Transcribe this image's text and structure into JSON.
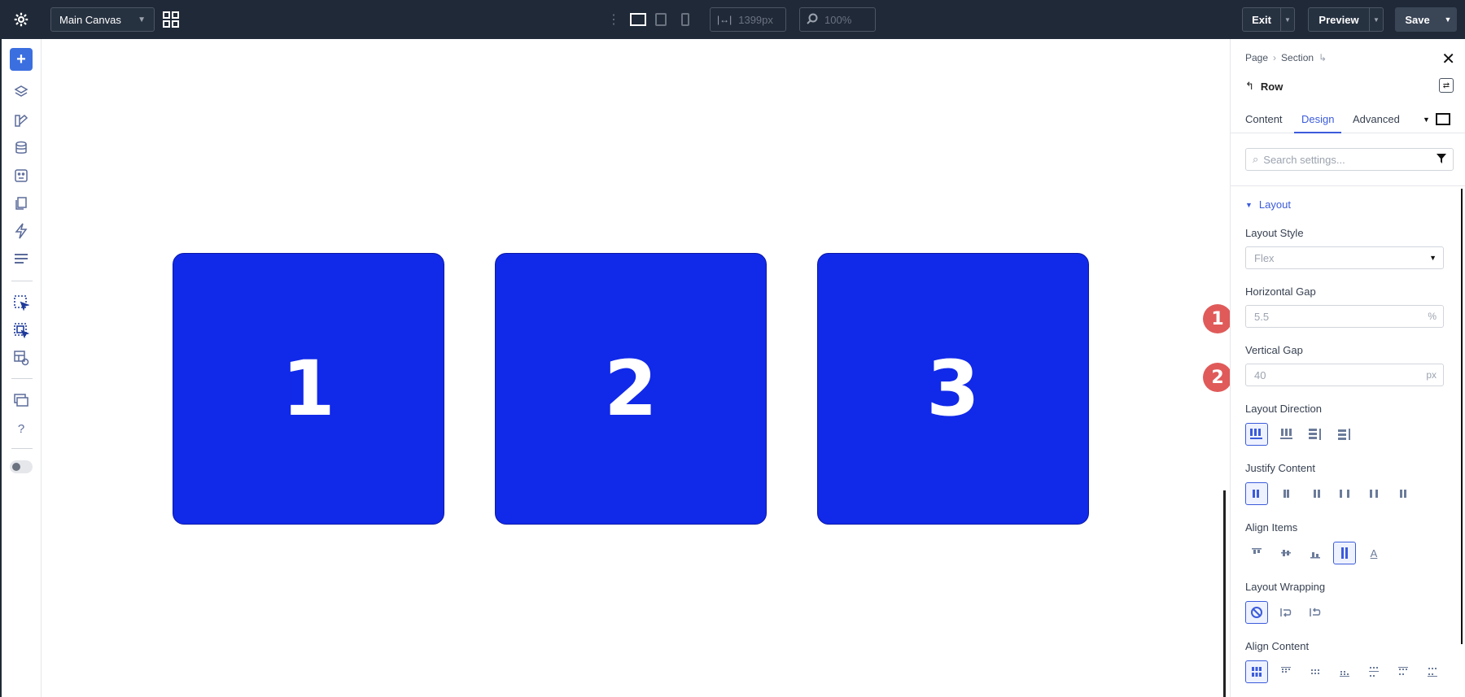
{
  "topbar": {
    "canvas_select": "Main Canvas",
    "width_readout": "1399px",
    "zoom_readout": "100%",
    "exit_label": "Exit",
    "preview_label": "Preview",
    "save_label": "Save"
  },
  "canvas": {
    "boxes": [
      "1",
      "2",
      "3"
    ],
    "box_color": "#1129e8"
  },
  "panel": {
    "breadcrumb": [
      "Page",
      "Section"
    ],
    "element_title": "Row",
    "tabs": [
      "Content",
      "Design",
      "Advanced"
    ],
    "active_tab": "Design",
    "search_placeholder": "Search settings...",
    "section_title": "Layout",
    "layout_style": {
      "label": "Layout Style",
      "value": "Flex"
    },
    "horizontal_gap": {
      "label": "Horizontal Gap",
      "value": "5.5",
      "unit": "%"
    },
    "vertical_gap": {
      "label": "Vertical Gap",
      "value": "40",
      "unit": "px"
    },
    "layout_direction_label": "Layout Direction",
    "justify_content_label": "Justify Content",
    "align_items_label": "Align Items",
    "layout_wrapping_label": "Layout Wrapping",
    "align_content_label": "Align Content",
    "accent_color": "#3b5bdb"
  },
  "annotations": [
    "1",
    "2"
  ]
}
